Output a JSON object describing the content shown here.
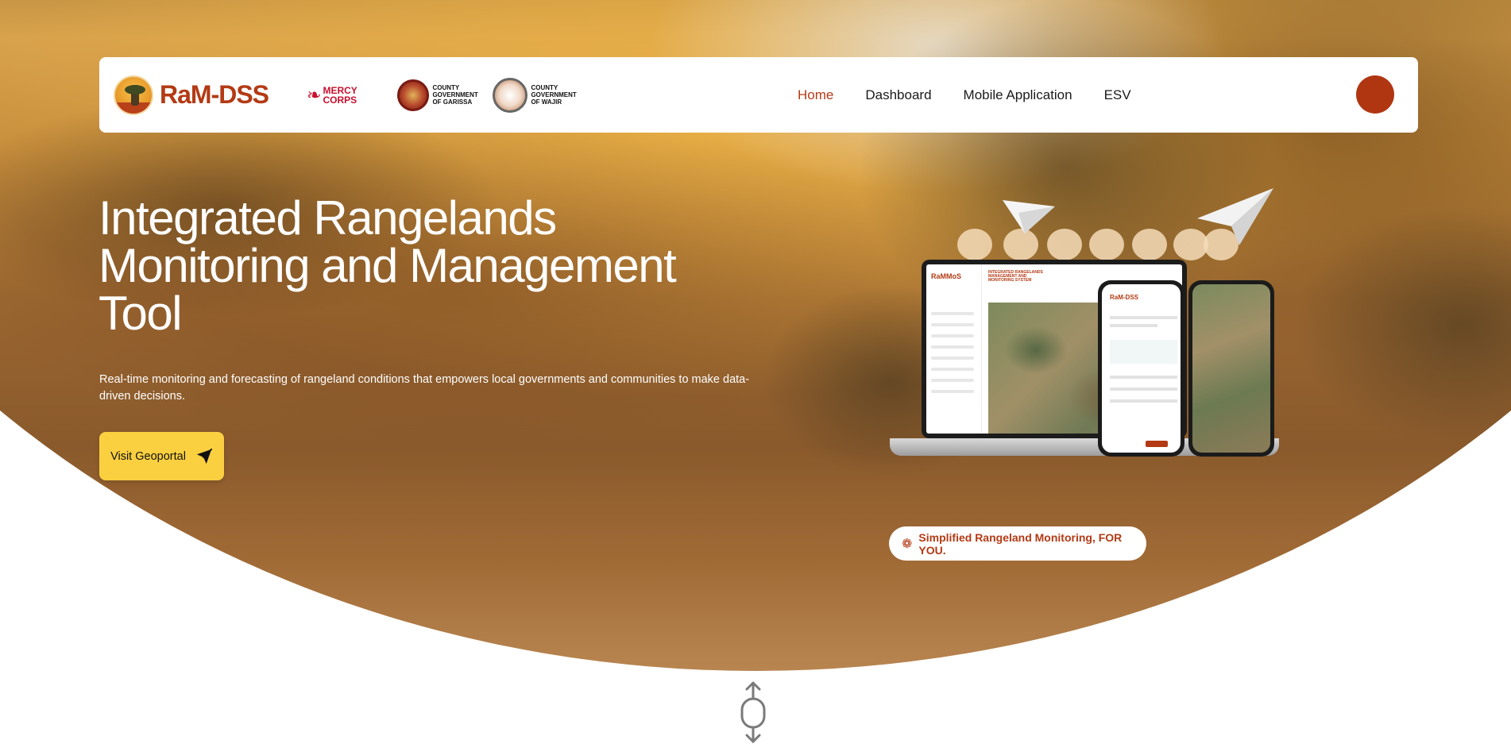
{
  "brand": {
    "name": "RaM-DSS"
  },
  "partners": {
    "mercy": "MERCY CORPS",
    "garissa": "COUNTY GOVERNMENT OF GARISSA",
    "wajir": "COUNTY GOVERNMENT OF WAJIR"
  },
  "nav": [
    {
      "label": "Home",
      "active": true
    },
    {
      "label": "Dashboard",
      "active": false
    },
    {
      "label": "Mobile Application",
      "active": false
    },
    {
      "label": "ESV",
      "active": false
    }
  ],
  "hero": {
    "title": "Integrated Rangelands Monitoring and Management Tool",
    "subtitle": "Real-time monitoring and forecasting of rangeland conditions that empowers local governments and communities to make data-driven decisions.",
    "cta": "Visit Geoportal",
    "tagline": "Simplified Rangeland Monitoring, FOR YOU."
  },
  "screen": {
    "logo": "RaMMoS",
    "heading": "INTEGRATED RANGELANDS MANAGEMENT AND MONITORING SYSTEM",
    "phone_brand": "RaM-DSS"
  },
  "icons": {
    "cta": "send-icon",
    "tagline": "logo-mark-icon",
    "scroll": "mouse-scroll-icon"
  },
  "colors": {
    "brand": "#b33a14",
    "cta": "#fbd040",
    "avatar": "#b03612"
  }
}
